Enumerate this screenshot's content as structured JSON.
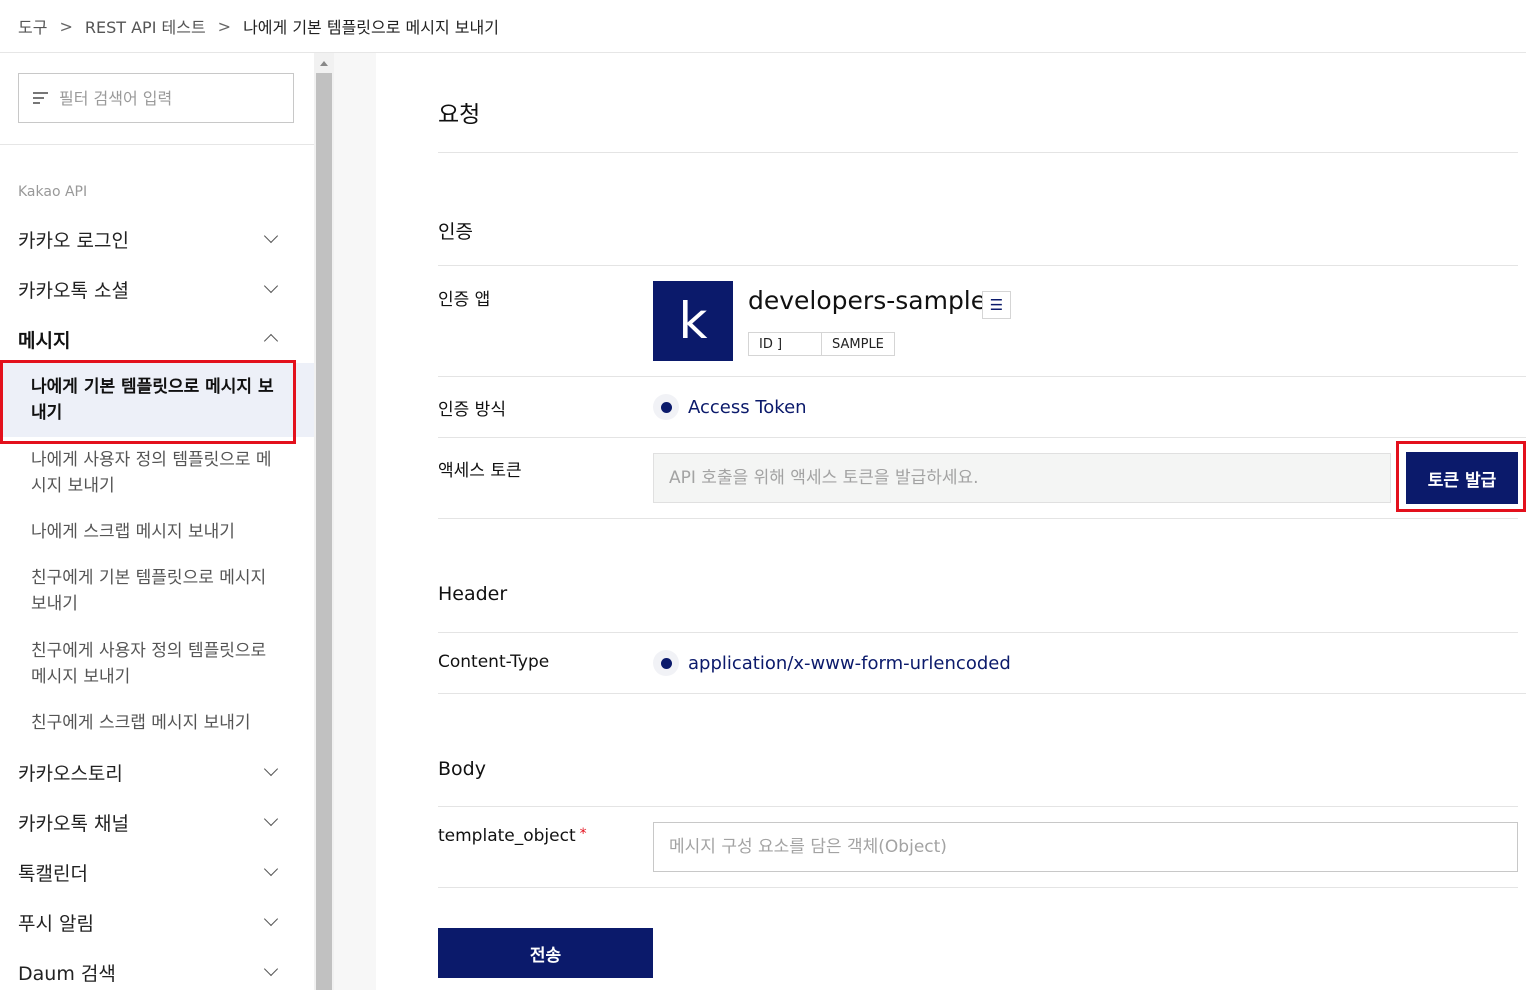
{
  "breadcrumb": {
    "items": [
      "도구",
      "REST API 테스트",
      "나에게 기본 템플릿으로 메시지 보내기"
    ],
    "separator": ">"
  },
  "sidebar": {
    "filter_placeholder": "필터 검색어 입력",
    "section_label": "Kakao API",
    "menu": [
      {
        "label": "카카오 로그인",
        "expanded": false
      },
      {
        "label": "카카오톡 소셜",
        "expanded": false
      },
      {
        "label": "메시지",
        "expanded": true
      },
      {
        "label": "카카오스토리",
        "expanded": false
      },
      {
        "label": "카카오톡 채널",
        "expanded": false
      },
      {
        "label": "톡캘린더",
        "expanded": false
      },
      {
        "label": "푸시 알림",
        "expanded": false
      },
      {
        "label": "Daum 검색",
        "expanded": false
      }
    ],
    "submenu": [
      {
        "line1": "나에게 기본 템플릿으로 메시지 보",
        "line2": "내기",
        "active": true
      },
      {
        "line1": "나에게 사용자 정의 템플릿으로 메",
        "line2": "시지 보내기",
        "active": false
      },
      {
        "line1": "나에게 스크랩 메시지 보내기",
        "line2": "",
        "active": false
      },
      {
        "line1": "친구에게 기본 템플릿으로 메시지",
        "line2": "보내기",
        "active": false
      },
      {
        "line1": "친구에게 사용자 정의 템플릿으로",
        "line2": "메시지 보내기",
        "active": false
      },
      {
        "line1": "친구에게 스크랩 메시지 보내기",
        "line2": "",
        "active": false
      }
    ]
  },
  "main": {
    "title": "요청",
    "auth": {
      "section_title": "인증",
      "app_label": "인증 앱",
      "app_logo_letter": "k",
      "app_name": "developers-sample",
      "app_id_tag": "ID ]",
      "app_sample_tag": "SAMPLE",
      "method_label": "인증 방식",
      "method_value": "Access Token",
      "token_label": "액세스 토큰",
      "token_placeholder": "API 호출을 위해 액세스 토큰을 발급하세요.",
      "token_button": "토큰 발급"
    },
    "header": {
      "section_title": "Header",
      "content_type_label": "Content-Type",
      "content_type_value": "application/x-www-form-urlencoded"
    },
    "body": {
      "section_title": "Body",
      "template_label": "template_object",
      "required_mark": "*",
      "template_placeholder": "메시지 구성 요소를 담은 객체(Object)"
    },
    "send_button": "전송"
  },
  "colors": {
    "brand_navy": "#0b1a6b",
    "highlight_red": "#e3101c",
    "active_bg": "#edf0f8"
  }
}
